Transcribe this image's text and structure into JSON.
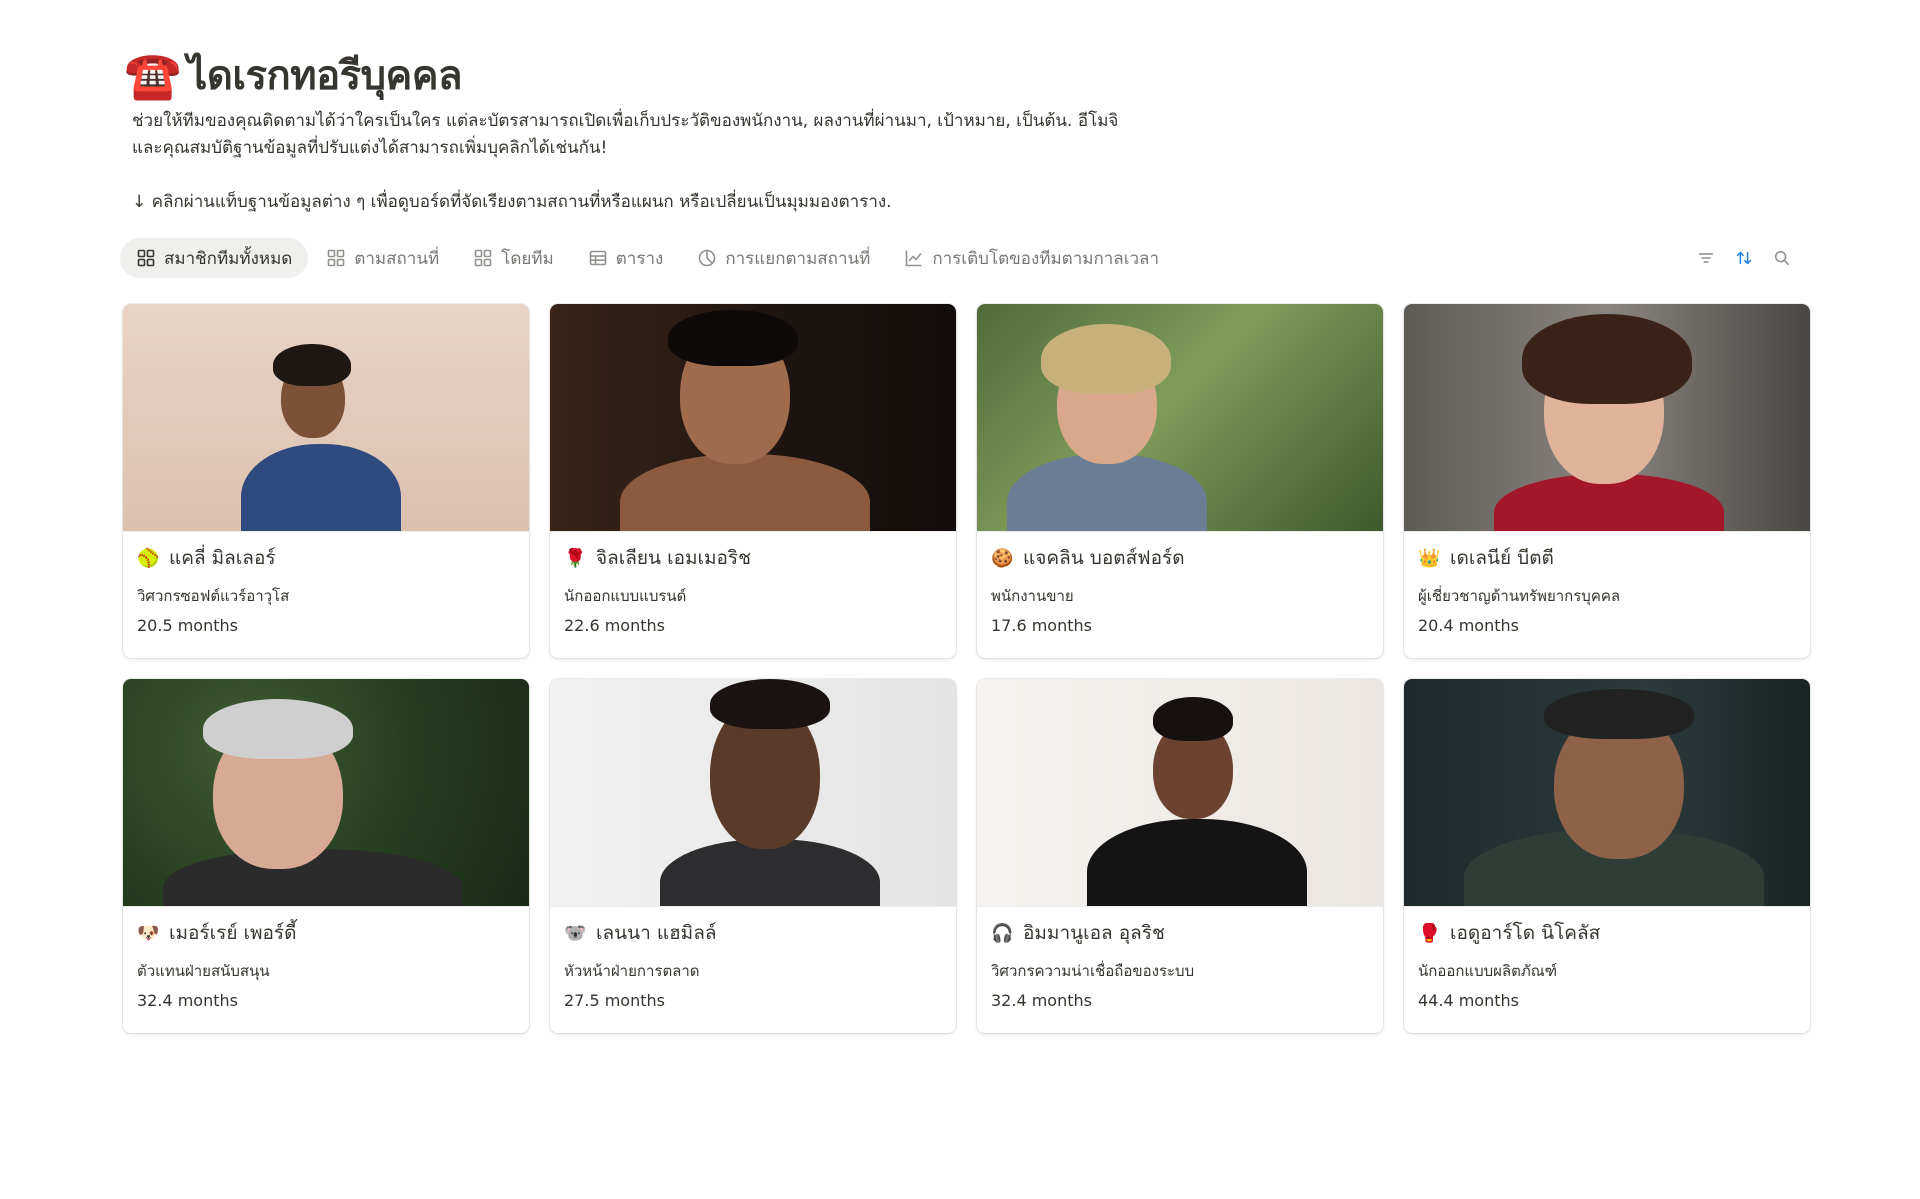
{
  "header": {
    "emoji": "☎️",
    "title": "ไดเรกทอรีบุคคล",
    "description": "ช่วยให้ทีมของคุณติดตามได้ว่าใครเป็นใคร แต่ละบัตรสามารถเปิดเพื่อเก็บประวัติของพนักงาน, ผลงานที่ผ่านมา, เป้าหมาย, เป็นต้น. อีโมจิและคุณสมบัติฐานข้อมูลที่ปรับแต่งได้สามารถเพิ่มบุคลิกได้เช่นกัน!",
    "hint": "↓ คลิกผ่านแท็บฐานข้อมูลต่าง ๆ เพื่อดูบอร์ดที่จัดเรียงตามสถานที่หรือแผนก หรือเปลี่ยนเป็นมุมมองตาราง."
  },
  "tabs": [
    {
      "label": "สมาชิกทีมทั้งหมด",
      "icon": "gallery-icon",
      "active": true
    },
    {
      "label": "ตามสถานที่",
      "icon": "gallery-icon",
      "active": false
    },
    {
      "label": "โดยทีม",
      "icon": "gallery-icon",
      "active": false
    },
    {
      "label": "ตาราง",
      "icon": "table-icon",
      "active": false
    },
    {
      "label": "การแยกตามสถานที่",
      "icon": "pie-chart-icon",
      "active": false
    },
    {
      "label": "การเติบโตของทีมตามกาลเวลา",
      "icon": "line-chart-icon",
      "active": false
    }
  ],
  "tools": [
    "filter-icon",
    "sort-icon",
    "search-icon"
  ],
  "accent_color": "#2383e2",
  "people": [
    {
      "emoji": "🥎",
      "name": "แคลี่ มิลเลอร์",
      "role": "วิศวกรซอฟต์แวร์อาวุโส",
      "tenure": "20.5 months"
    },
    {
      "emoji": "🌹",
      "name": "จิลเลียน เอมเมอริช",
      "role": "นักออกแบบแบรนด์",
      "tenure": "22.6 months"
    },
    {
      "emoji": "🍪",
      "name": "แจคลิน บอตส์ฟอร์ด",
      "role": "พนักงานขาย",
      "tenure": "17.6 months"
    },
    {
      "emoji": "👑",
      "name": "เดเลนีย์ บีตตี",
      "role": "ผู้เชี่ยวชาญด้านทรัพยากรบุคคล",
      "tenure": "20.4 months"
    },
    {
      "emoji": "🐶",
      "name": "เมอร์เรย์ เพอร์ดี้",
      "role": "ตัวแทนฝ่ายสนับสนุน",
      "tenure": "32.4 months"
    },
    {
      "emoji": "🐨",
      "name": "เลนนา แฮมิลล์",
      "role": "หัวหน้าฝ่ายการตลาด",
      "tenure": "27.5 months"
    },
    {
      "emoji": "🎧",
      "name": "อิมมานูเอล อุลริช",
      "role": "วิศวกรความน่าเชื่อถือของระบบ",
      "tenure": "32.4 months"
    },
    {
      "emoji": "🥊",
      "name": "เอดูอาร์โด นิโคลัส",
      "role": "นักออกแบบผลิตภัณฑ์",
      "tenure": "44.4 months"
    }
  ]
}
